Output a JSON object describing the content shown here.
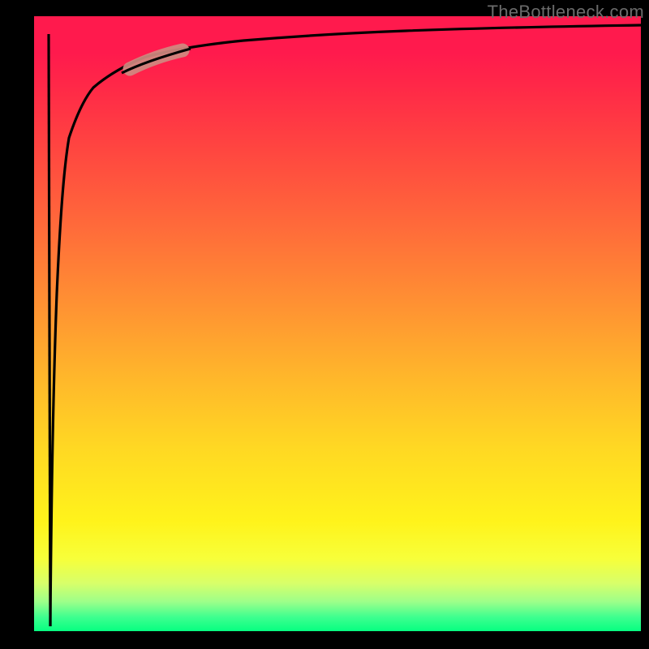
{
  "watermark": {
    "text": "TheBottleneck.com"
  },
  "chart_data": {
    "type": "line",
    "title": "",
    "xlabel": "",
    "ylabel": "",
    "xlim": [
      0,
      100
    ],
    "ylim": [
      0,
      100
    ],
    "gradient_stops": [
      {
        "pos": 0,
        "color": "#ff1a4d"
      },
      {
        "pos": 0.45,
        "color": "#ff8f33"
      },
      {
        "pos": 0.8,
        "color": "#fff31b"
      },
      {
        "pos": 1.0,
        "color": "#00ff7f"
      }
    ],
    "series": [
      {
        "name": "curve",
        "x": [
          3,
          3.2,
          3.5,
          4,
          5,
          6,
          8,
          10,
          13,
          16,
          20,
          25,
          30,
          40,
          50,
          60,
          80,
          100
        ],
        "y": [
          1,
          18,
          38,
          55,
          70,
          78,
          84,
          87,
          89.5,
          91,
          92.3,
          93.3,
          94.1,
          95.2,
          96,
          96.5,
          97.2,
          97.8
        ]
      },
      {
        "name": "spike-down",
        "x": [
          2.7,
          3
        ],
        "y": [
          97,
          1
        ]
      }
    ],
    "highlight_segment": {
      "series": "curve",
      "x_range": [
        16,
        25
      ],
      "y_range": [
        91,
        93.3
      ],
      "color": "#d08a7e",
      "width": 14
    }
  }
}
